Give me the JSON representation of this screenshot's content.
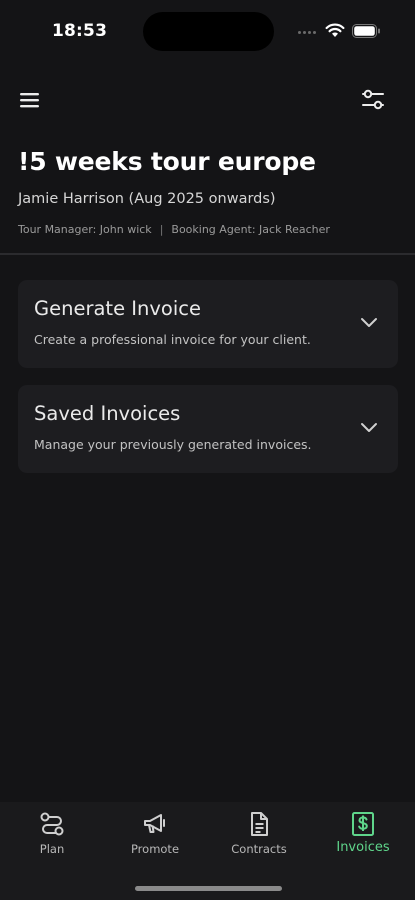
{
  "status_bar": {
    "time": "18:53"
  },
  "header": {
    "title": "!5 weeks tour europe",
    "subtitle": "Jamie Harrison (Aug 2025 onwards)",
    "tour_manager": "Tour Manager: John wick",
    "separator": "|",
    "booking_agent": "Booking Agent: Jack Reacher"
  },
  "cards": [
    {
      "title": "Generate Invoice",
      "description": "Create a professional invoice for your client."
    },
    {
      "title": "Saved Invoices",
      "description": "Manage your previously generated invoices."
    }
  ],
  "tab_bar": {
    "active": "Invoices",
    "tabs": [
      {
        "label": "Plan",
        "icon": "route-icon"
      },
      {
        "label": "Promote",
        "icon": "megaphone-icon"
      },
      {
        "label": "Contracts",
        "icon": "document-icon"
      },
      {
        "label": "Invoices",
        "icon": "dollar-receipt-icon"
      }
    ]
  },
  "colors": {
    "background": "#141416",
    "card": "#1d1d20",
    "accent": "#5fd58b",
    "text": "#ececec"
  }
}
